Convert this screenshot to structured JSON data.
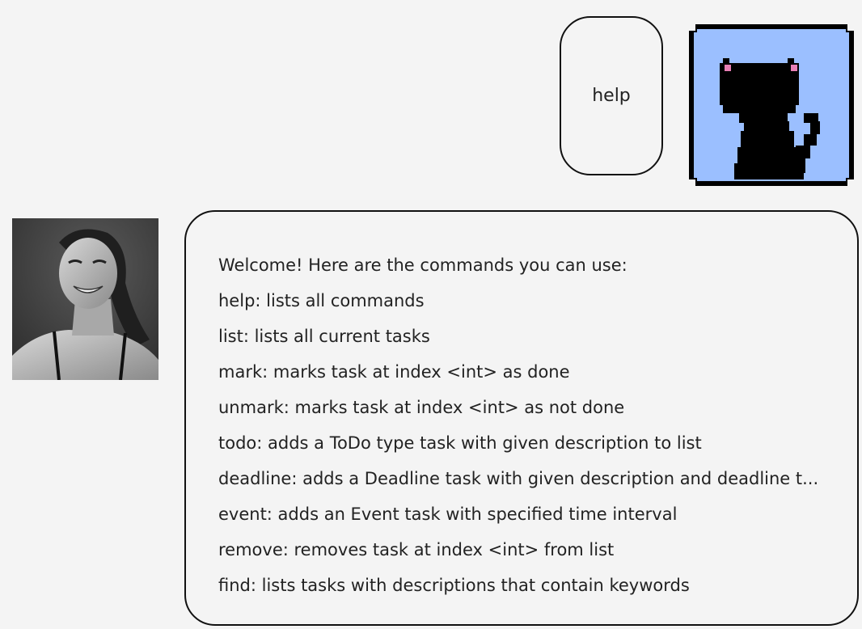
{
  "user_message": {
    "text": "help"
  },
  "bot_message": {
    "lines": [
      "Welcome! Here are the commands you can use:",
      "help: lists all commands",
      "list: lists all current tasks",
      "mark: marks task at index <int> as done",
      "unmark: marks task at index <int> as not done",
      "todo: adds a ToDo type task with given description to list",
      "deadline: adds a Deadline task with given description and deadline t...",
      "event: adds an Event task with specified time interval",
      "remove: removes task at index <int> from list",
      "find: lists tasks with descriptions that contain keywords"
    ]
  },
  "avatars": {
    "user": "pixel-cat-icon",
    "bot": "woman-portrait"
  },
  "colors": {
    "background": "#f4f4f4",
    "cat_background": "#9bbfff",
    "cat_ear_pink": "#e87fb5",
    "border": "#111111"
  }
}
